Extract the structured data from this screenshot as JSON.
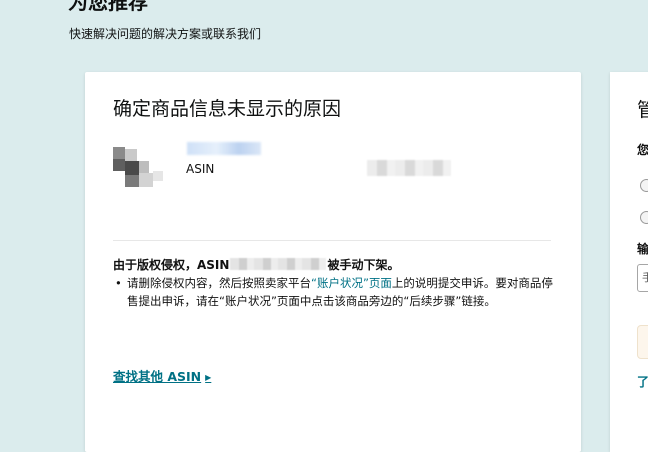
{
  "header": {
    "title": "为您推荐",
    "subtitle": "快速解决问题的解决方案或联系我们"
  },
  "card": {
    "title": "确定商品信息未显示的原因",
    "product": {
      "asin_label": "ASIN"
    },
    "reason_prefix": "由于版权侵权，ASIN",
    "reason_suffix": "被手动下架。",
    "instruction_part1": "请删除侵权内容，然后按照卖家平台",
    "instruction_link": "“账户状况”页面",
    "instruction_part2": "上的说明提交申诉。要对商品停售提出申诉，请在“账户状况”页面中点击该商品旁边的“后续步骤”链接。",
    "find_other_asin": "查找其他 ASIN"
  },
  "card2": {
    "title": "管",
    "question": "您",
    "input_label": "输",
    "input_value": "手",
    "link": "了"
  },
  "colors": {
    "background": "#dbeced",
    "link": "#007185",
    "text": "#0f1111"
  },
  "icons": {
    "find_link_arrow": "triangle-right"
  }
}
